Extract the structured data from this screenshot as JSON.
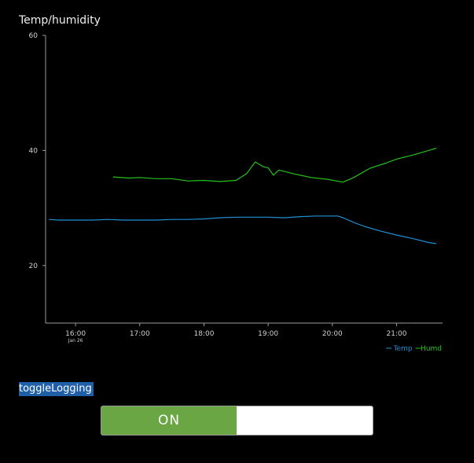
{
  "chart_data": {
    "type": "line",
    "title": "Temp/humidity",
    "ylim": [
      10,
      60
    ],
    "yticks": [
      20,
      40,
      60
    ],
    "x_domain": [
      "15:32",
      "21:43"
    ],
    "xticks": [
      {
        "label": "16:00",
        "sublabel": "Jan 26"
      },
      {
        "label": "17:00"
      },
      {
        "label": "18:00"
      },
      {
        "label": "19:00"
      },
      {
        "label": "20:00"
      },
      {
        "label": "21:00"
      }
    ],
    "grid": false,
    "legend": "bottom-right",
    "series": [
      {
        "name": "Temp",
        "color": "#1f8fd6",
        "points": [
          [
            "15:35",
            28.0
          ],
          [
            "15:45",
            27.9
          ],
          [
            "16:00",
            27.9
          ],
          [
            "16:15",
            27.9
          ],
          [
            "16:30",
            28.0
          ],
          [
            "16:45",
            27.9
          ],
          [
            "17:00",
            27.9
          ],
          [
            "17:15",
            27.9
          ],
          [
            "17:30",
            28.0
          ],
          [
            "17:45",
            28.0
          ],
          [
            "18:00",
            28.1
          ],
          [
            "18:15",
            28.3
          ],
          [
            "18:30",
            28.4
          ],
          [
            "18:45",
            28.4
          ],
          [
            "19:00",
            28.4
          ],
          [
            "19:15",
            28.3
          ],
          [
            "19:30",
            28.5
          ],
          [
            "19:45",
            28.6
          ],
          [
            "20:00",
            28.6
          ],
          [
            "20:05",
            28.6
          ],
          [
            "20:10",
            28.3
          ],
          [
            "20:20",
            27.5
          ],
          [
            "20:30",
            26.8
          ],
          [
            "20:45",
            26.0
          ],
          [
            "21:00",
            25.3
          ],
          [
            "21:15",
            24.7
          ],
          [
            "21:30",
            24.0
          ],
          [
            "21:37",
            23.8
          ]
        ]
      },
      {
        "name": "Humd",
        "color": "#25c21b",
        "points": [
          [
            "16:35",
            35.4
          ],
          [
            "16:50",
            35.2
          ],
          [
            "17:00",
            35.3
          ],
          [
            "17:15",
            35.1
          ],
          [
            "17:30",
            35.1
          ],
          [
            "17:45",
            34.7
          ],
          [
            "18:00",
            34.8
          ],
          [
            "18:15",
            34.6
          ],
          [
            "18:30",
            34.8
          ],
          [
            "18:40",
            36.0
          ],
          [
            "18:48",
            38.0
          ],
          [
            "18:55",
            37.2
          ],
          [
            "19:00",
            37.0
          ],
          [
            "19:05",
            35.7
          ],
          [
            "19:10",
            36.6
          ],
          [
            "19:25",
            35.9
          ],
          [
            "19:40",
            35.3
          ],
          [
            "19:55",
            35.0
          ],
          [
            "20:10",
            34.5
          ],
          [
            "20:20",
            35.3
          ],
          [
            "20:35",
            36.9
          ],
          [
            "20:50",
            37.8
          ],
          [
            "21:00",
            38.5
          ],
          [
            "21:15",
            39.2
          ],
          [
            "21:30",
            40.0
          ],
          [
            "21:37",
            40.4
          ]
        ]
      }
    ]
  },
  "toggle": {
    "label": "toggleLogging",
    "state_text": "ON",
    "on_color": "#6aa644"
  }
}
